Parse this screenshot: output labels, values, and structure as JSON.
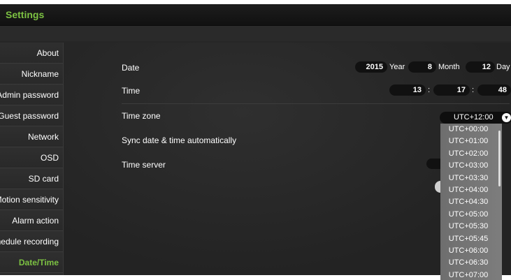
{
  "app": {
    "title": "Settings"
  },
  "sidebar": {
    "items": [
      {
        "label": "About"
      },
      {
        "label": "Nickname"
      },
      {
        "label": "Admin password"
      },
      {
        "label": "Guest password"
      },
      {
        "label": "Network"
      },
      {
        "label": "OSD"
      },
      {
        "label": "SD card"
      },
      {
        "label": "Motion sensitivity"
      },
      {
        "label": "Alarm action"
      },
      {
        "label": "Schedule recording"
      },
      {
        "label": "Date/Time"
      }
    ],
    "active_index": 10
  },
  "date": {
    "label": "Date",
    "year": "2015",
    "year_unit": "Year",
    "month": "8",
    "month_unit": "Month",
    "day": "12",
    "day_unit": "Day"
  },
  "time": {
    "label": "Time",
    "hour": "13",
    "minute": "17",
    "second": "48",
    "separator": ":"
  },
  "timezone": {
    "label": "Time zone",
    "selected": "UTC+12:00",
    "options": [
      "UTC+00:00",
      "UTC+01:00",
      "UTC+02:00",
      "UTC+03:00",
      "UTC+03:30",
      "UTC+04:00",
      "UTC+04:30",
      "UTC+05:00",
      "UTC+05:30",
      "UTC+05:45",
      "UTC+06:00",
      "UTC+06:30",
      "UTC+07:00"
    ]
  },
  "sync": {
    "label": "Sync date & time automatically"
  },
  "time_server": {
    "label": "Time server"
  },
  "colors": {
    "accent": "#7cc142",
    "background": "#262626",
    "dropdown": "#767676"
  }
}
